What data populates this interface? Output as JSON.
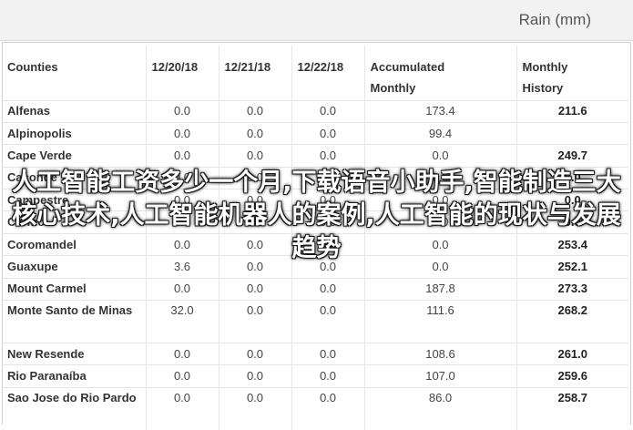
{
  "header": {
    "title": "Rain (mm)"
  },
  "table": {
    "columns": [
      "Counties",
      "12/20/18",
      "12/21/18",
      "12/22/18",
      "Accumulated Monthly",
      "Monthly History"
    ],
    "rows": [
      [
        "Alfenas",
        "0.0",
        "0.0",
        "0.0",
        "173.4",
        "211.6"
      ],
      [
        "Alpinopolis",
        "0.0",
        "0.0",
        "0.0",
        "99.4",
        ""
      ],
      [
        "Cape Verde",
        "0.0",
        "0.0",
        "0.0",
        "0.0",
        "249.7"
      ],
      [
        "Caconde",
        "0.0",
        "0.0",
        "0.0",
        "0.0",
        "0.0"
      ],
      [
        "Campestre",
        "0.0",
        "0.0",
        "0.0",
        "0.0",
        "0.0"
      ],
      [
        "Carmo",
        "0.0",
        "0.0",
        "0.0",
        "0.0",
        "0.0"
      ],
      [
        "Coromandel",
        "0.0",
        "0.0",
        "0.0",
        "0.0",
        "253.4"
      ],
      [
        "Guaxupe",
        "3.6",
        "0.0",
        "0.0",
        "0.0",
        "252.1"
      ],
      [
        "Mount Carmel",
        "0.0",
        "0.0",
        "0.0",
        "187.8",
        "273.3"
      ],
      [
        "Monte Santo de Minas",
        "32.0",
        "0.0",
        "0.0",
        "111.6",
        "268.2"
      ],
      [
        "New Resende",
        "0.0",
        "0.0",
        "0.0",
        "108.6",
        "261.0"
      ],
      [
        "Rio Paranaíba",
        "0.0",
        "0.0",
        "0.0",
        "107.0",
        "259.6"
      ],
      [
        "Sao Jose do Rio Pardo",
        "0.0",
        "0.0",
        "0.0",
        "86.0",
        "258.7"
      ]
    ]
  },
  "overlay_text": "人工智能工资多少一个月,下载语音小助手,智能制造三大核心技术,人工智能机器人的案例,人工智能的现状与发展趋势"
}
